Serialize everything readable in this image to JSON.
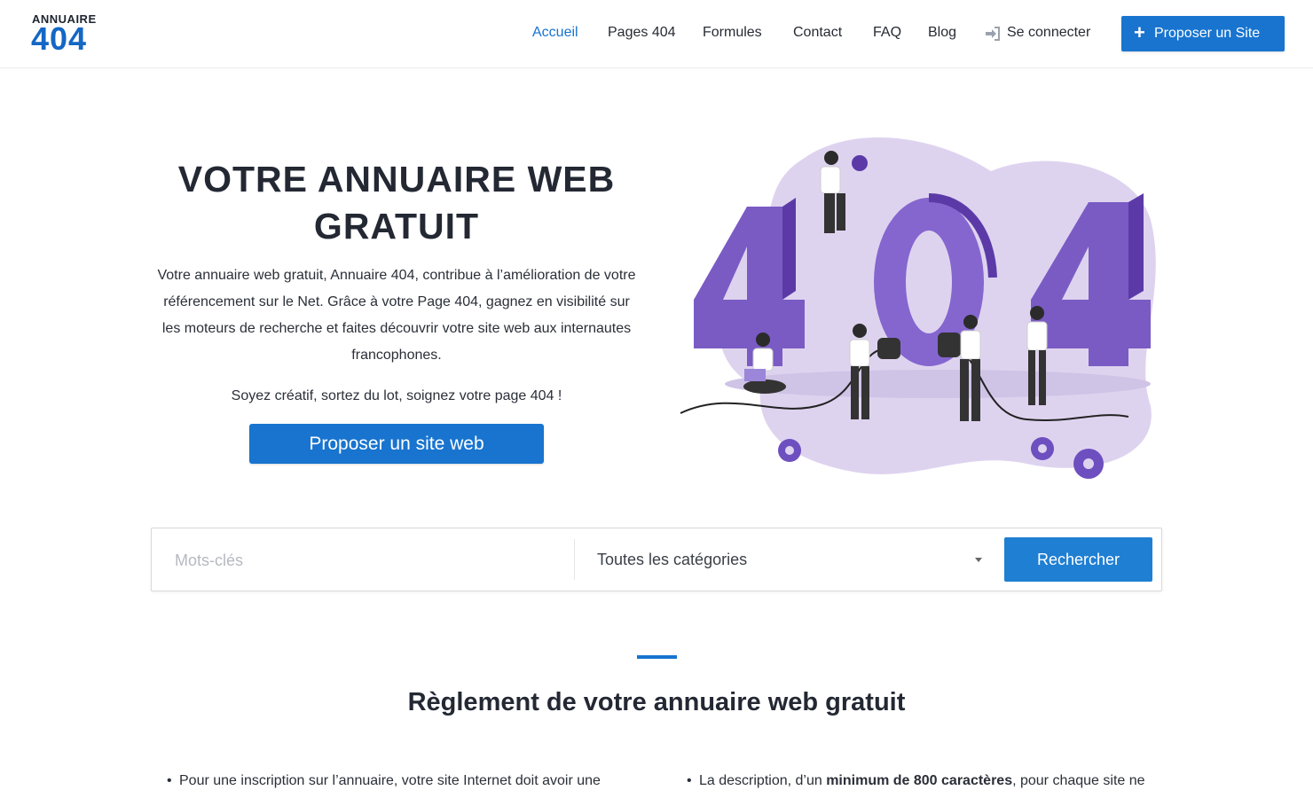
{
  "header": {
    "logo_top": "ANNUAIRE",
    "logo_num": "404",
    "nav": [
      "Accueil",
      "Pages 404",
      "Formules",
      "Contact",
      "FAQ",
      "Blog"
    ],
    "login_label": "Se connecter",
    "cta_label": "Proposer un Site",
    "accent_color": "#1874cf"
  },
  "hero": {
    "title_line1": "VOTRE ANNUAIRE WEB",
    "title_line2": "GRATUIT",
    "description": "Votre annuaire web gratuit, Annuaire 404, contribue à l’amélioration de votre référencement sur le Net. Grâce à votre Page 404, gagnez en visibilité sur les moteurs de recherche et faites découvrir votre site web aux internautes francophones.",
    "subline": "Soyez créatif, sortez du lot, soignez votre page 404 !",
    "button_label": "Proposer un site web"
  },
  "search": {
    "keywords_placeholder": "Mots-clés",
    "category_value": "Toutes les catégories",
    "button_label": "Rechercher"
  },
  "rules": {
    "title": "Règlement de votre annuaire web gratuit",
    "left_text": "Pour une inscription sur l’annuaire, votre site Internet doit avoir une",
    "right_pre": "La description, d’un ",
    "right_bold": "minimum de 800 caractères",
    "right_post": ", pour chaque site ne"
  }
}
